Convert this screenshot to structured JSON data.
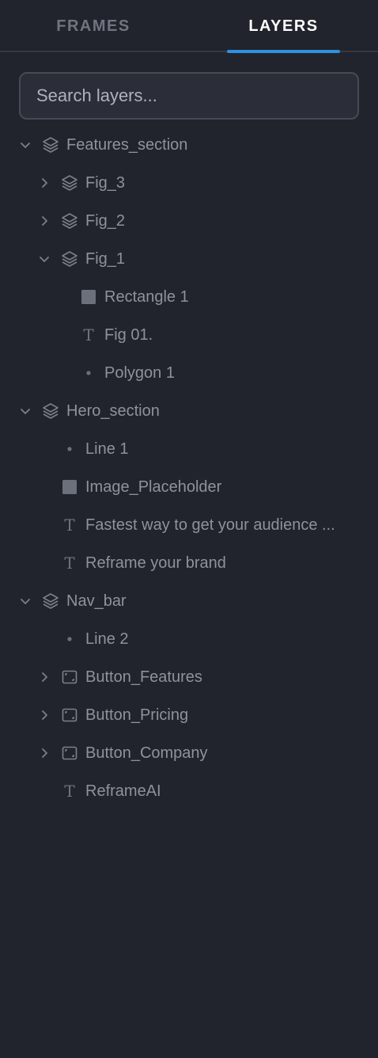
{
  "tabs": {
    "frames": "FRAMES",
    "layers": "LAYERS"
  },
  "search": {
    "placeholder": "Search layers..."
  },
  "layers": {
    "features_section": "Features_section",
    "fig_3": "Fig_3",
    "fig_2": "Fig_2",
    "fig_1": "Fig_1",
    "rectangle_1": "Rectangle 1",
    "fig_01_text": "Fig 01.",
    "polygon_1": "Polygon 1",
    "hero_section": "Hero_section",
    "line_1": "Line 1",
    "image_placeholder": "Image_Placeholder",
    "fastest_way_text": "Fastest way to get your audience ...",
    "reframe_brand_text": "Reframe your brand",
    "nav_bar": "Nav_bar",
    "line_2": "Line 2",
    "button_features": "Button_Features",
    "button_pricing": "Button_Pricing",
    "button_company": "Button_Company",
    "reframeai_text": "ReframeAI"
  },
  "glyphs": {
    "text_layer": "T"
  },
  "colors": {
    "background": "#21242d",
    "accent": "#2f8fe0",
    "text_muted": "#8e929c",
    "tab_active": "#ffffff"
  }
}
